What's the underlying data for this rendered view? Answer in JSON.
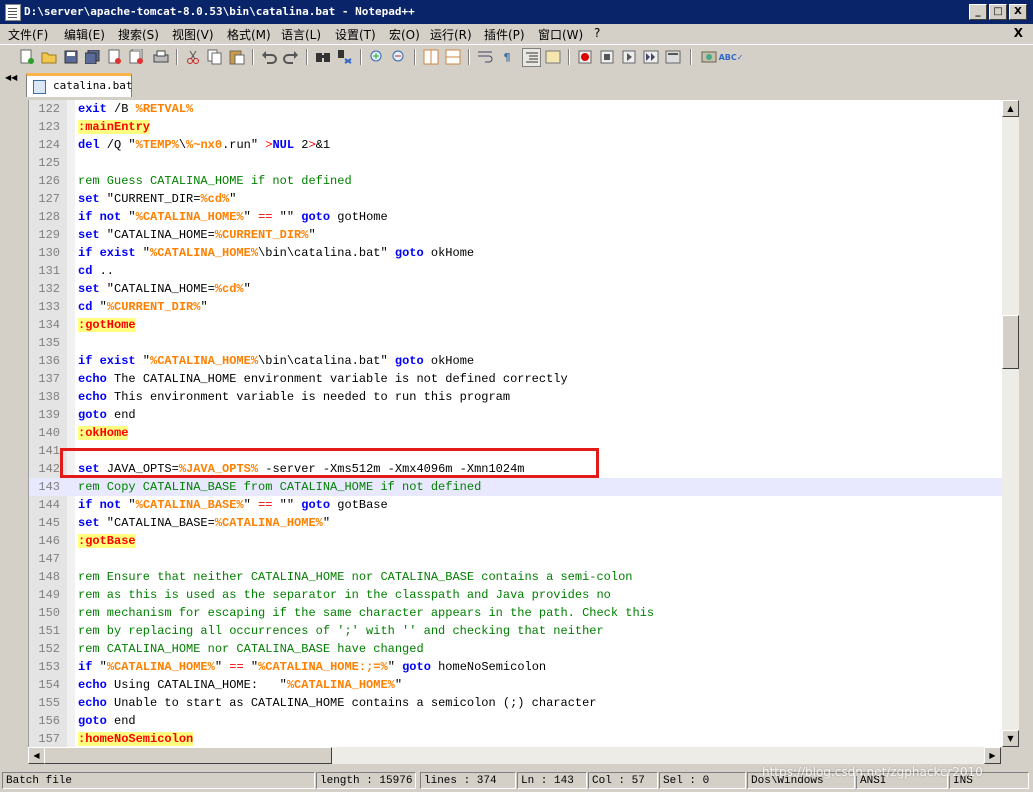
{
  "window": {
    "title": "D:\\server\\apache-tomcat-8.0.53\\bin\\catalina.bat - Notepad++",
    "buttons": {
      "minimize": "_",
      "maximize": "□",
      "close": "X"
    }
  },
  "menu": {
    "items": [
      "文件(F)",
      "编辑(E)",
      "搜索(S)",
      "视图(V)",
      "格式(M)",
      "语言(L)",
      "设置(T)",
      "宏(O)",
      "运行(R)",
      "插件(P)",
      "窗口(W)",
      "?"
    ],
    "close": "X"
  },
  "tab": {
    "label": "catalina.bat"
  },
  "editor": {
    "current_line": 143,
    "lines": [
      {
        "n": "122",
        "code": [
          [
            "kw",
            "exit"
          ],
          [
            "t",
            " /B "
          ],
          [
            "var",
            "%RETVAL%"
          ]
        ]
      },
      {
        "n": "123",
        "code": [
          [
            "lbl",
            ":mainEntry"
          ]
        ]
      },
      {
        "n": "124",
        "code": [
          [
            "kw",
            "del"
          ],
          [
            "t",
            " /Q \""
          ],
          [
            "var",
            "%TEMP%"
          ],
          [
            "t",
            "\\"
          ],
          [
            "var",
            "%~nx0"
          ],
          [
            "t",
            ".run\" "
          ],
          [
            "op",
            ">"
          ],
          [
            "kw",
            "NUL"
          ],
          [
            "t",
            " 2"
          ],
          [
            "op",
            ">"
          ],
          [
            "t",
            "&1"
          ]
        ]
      },
      {
        "n": "125",
        "code": []
      },
      {
        "n": "126",
        "code": [
          [
            "cm",
            "rem Guess CATALINA_HOME if not defined"
          ]
        ]
      },
      {
        "n": "127",
        "code": [
          [
            "kw",
            "set"
          ],
          [
            "t",
            " \"CURRENT_DIR="
          ],
          [
            "var",
            "%cd%"
          ],
          [
            "t",
            "\""
          ]
        ]
      },
      {
        "n": "128",
        "code": [
          [
            "kw",
            "if not"
          ],
          [
            "t",
            " \""
          ],
          [
            "var",
            "%CATALINA_HOME%"
          ],
          [
            "t",
            "\" "
          ],
          [
            "op",
            "=="
          ],
          [
            "t",
            " \"\" "
          ],
          [
            "kw",
            "goto"
          ],
          [
            "t",
            " gotHome"
          ]
        ]
      },
      {
        "n": "129",
        "code": [
          [
            "kw",
            "set"
          ],
          [
            "t",
            " \"CATALINA_HOME="
          ],
          [
            "var",
            "%CURRENT_DIR%"
          ],
          [
            "t",
            "\""
          ]
        ]
      },
      {
        "n": "130",
        "code": [
          [
            "kw",
            "if exist"
          ],
          [
            "t",
            " \""
          ],
          [
            "var",
            "%CATALINA_HOME%"
          ],
          [
            "t",
            "\\bin\\catalina.bat\" "
          ],
          [
            "kw",
            "goto"
          ],
          [
            "t",
            " okHome"
          ]
        ]
      },
      {
        "n": "131",
        "code": [
          [
            "kw",
            "cd"
          ],
          [
            "t",
            " .."
          ]
        ]
      },
      {
        "n": "132",
        "code": [
          [
            "kw",
            "set"
          ],
          [
            "t",
            " \"CATALINA_HOME="
          ],
          [
            "var",
            "%cd%"
          ],
          [
            "t",
            "\""
          ]
        ]
      },
      {
        "n": "133",
        "code": [
          [
            "kw",
            "cd"
          ],
          [
            "t",
            " \""
          ],
          [
            "var",
            "%CURRENT_DIR%"
          ],
          [
            "t",
            "\""
          ]
        ]
      },
      {
        "n": "134",
        "code": [
          [
            "lbl",
            ":gotHome"
          ]
        ]
      },
      {
        "n": "135",
        "code": []
      },
      {
        "n": "136",
        "code": [
          [
            "kw",
            "if exist"
          ],
          [
            "t",
            " \""
          ],
          [
            "var",
            "%CATALINA_HOME%"
          ],
          [
            "t",
            "\\bin\\catalina.bat\" "
          ],
          [
            "kw",
            "goto"
          ],
          [
            "t",
            " okHome"
          ]
        ]
      },
      {
        "n": "137",
        "code": [
          [
            "kw",
            "echo"
          ],
          [
            "t",
            " The CATALINA_HOME environment variable is not defined correctly"
          ]
        ]
      },
      {
        "n": "138",
        "code": [
          [
            "kw",
            "echo"
          ],
          [
            "t",
            " This environment variable is needed to run this program"
          ]
        ]
      },
      {
        "n": "139",
        "code": [
          [
            "kw",
            "goto"
          ],
          [
            "t",
            " end"
          ]
        ]
      },
      {
        "n": "140",
        "code": [
          [
            "lbl",
            ":okHome"
          ]
        ]
      },
      {
        "n": "141",
        "code": []
      },
      {
        "n": "142",
        "code": [
          [
            "kw",
            "set"
          ],
          [
            "t",
            " JAVA_OPTS="
          ],
          [
            "var",
            "%JAVA_OPTS%"
          ],
          [
            "t",
            " -server -Xms512m -Xmx4096m -Xmn1024m"
          ]
        ]
      },
      {
        "n": "143",
        "code": [
          [
            "cm",
            "rem Copy CATALINA_BASE from CATALINA_HOME if not defined"
          ]
        ]
      },
      {
        "n": "144",
        "code": [
          [
            "kw",
            "if not"
          ],
          [
            "t",
            " \""
          ],
          [
            "var",
            "%CATALINA_BASE%"
          ],
          [
            "t",
            "\" "
          ],
          [
            "op",
            "=="
          ],
          [
            "t",
            " \"\" "
          ],
          [
            "kw",
            "goto"
          ],
          [
            "t",
            " gotBase"
          ]
        ]
      },
      {
        "n": "145",
        "code": [
          [
            "kw",
            "set"
          ],
          [
            "t",
            " \"CATALINA_BASE="
          ],
          [
            "var",
            "%CATALINA_HOME%"
          ],
          [
            "t",
            "\""
          ]
        ]
      },
      {
        "n": "146",
        "code": [
          [
            "lbl",
            ":gotBase"
          ]
        ]
      },
      {
        "n": "147",
        "code": []
      },
      {
        "n": "148",
        "code": [
          [
            "cm",
            "rem Ensure that neither CATALINA_HOME nor CATALINA_BASE contains a semi-colon"
          ]
        ]
      },
      {
        "n": "149",
        "code": [
          [
            "cm",
            "rem as this is used as the separator in the classpath and Java provides no"
          ]
        ]
      },
      {
        "n": "150",
        "code": [
          [
            "cm",
            "rem mechanism for escaping if the same character appears in the path. Check this"
          ]
        ]
      },
      {
        "n": "151",
        "code": [
          [
            "cm",
            "rem by replacing all occurrences of ';' with '' and checking that neither"
          ]
        ]
      },
      {
        "n": "152",
        "code": [
          [
            "cm",
            "rem CATALINA_HOME nor CATALINA_BASE have changed"
          ]
        ]
      },
      {
        "n": "153",
        "code": [
          [
            "kw",
            "if"
          ],
          [
            "t",
            " \""
          ],
          [
            "var",
            "%CATALINA_HOME%"
          ],
          [
            "t",
            "\" "
          ],
          [
            "op",
            "=="
          ],
          [
            "t",
            " \""
          ],
          [
            "var",
            "%CATALINA_HOME:;=%"
          ],
          [
            "t",
            "\" "
          ],
          [
            "kw",
            "goto"
          ],
          [
            "t",
            " homeNoSemicolon"
          ]
        ]
      },
      {
        "n": "154",
        "code": [
          [
            "kw",
            "echo"
          ],
          [
            "t",
            " Using CATALINA_HOME:   \""
          ],
          [
            "var",
            "%CATALINA_HOME%"
          ],
          [
            "t",
            "\""
          ]
        ]
      },
      {
        "n": "155",
        "code": [
          [
            "kw",
            "echo"
          ],
          [
            "t",
            " Unable to start as CATALINA_HOME contains a semicolon (;) character"
          ]
        ]
      },
      {
        "n": "156",
        "code": [
          [
            "kw",
            "goto"
          ],
          [
            "t",
            " end"
          ]
        ]
      },
      {
        "n": "157",
        "code": [
          [
            "lbl",
            ":homeNoSemicolon"
          ]
        ]
      }
    ]
  },
  "status": {
    "filetype": "Batch file",
    "length": "length : 15976",
    "lines": "lines : 374",
    "ln": "Ln : 143",
    "col": "Col : 57",
    "sel": "Sel : 0",
    "eol": "Dos\\Windows",
    "encoding": "ANSI",
    "mode": "INS"
  },
  "watermark": "https://blog.csdn.net/zgphacker2010"
}
